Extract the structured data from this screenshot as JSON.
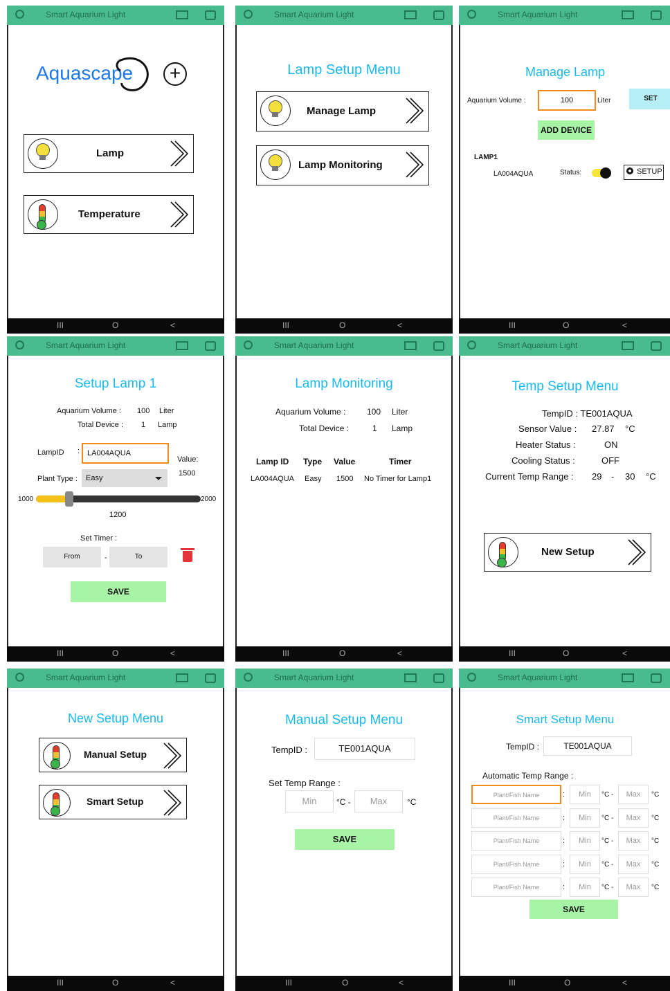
{
  "app_title": "Smart Aquarium Light",
  "nav": {
    "recents": "III",
    "home": "O",
    "back": "<"
  },
  "s1": {
    "logo": "Aquascape",
    "add": "+",
    "lamp": "Lamp",
    "temperature": "Temperature"
  },
  "s2": {
    "heading": "Lamp Setup Menu",
    "manage": "Manage Lamp",
    "monitoring": "Lamp Monitoring"
  },
  "s3": {
    "heading": "Manage Lamp",
    "vol_label": "Aquarium Volume :",
    "vol_value": "100",
    "unit": "Liter",
    "set": "SET",
    "add_device": "ADD DEVICE",
    "lamp_name": "LAMP1",
    "lamp_id": "LA004AQUA",
    "status_label": "Status:",
    "setup": "SETUP"
  },
  "s4": {
    "heading": "Setup Lamp 1",
    "vol_label": "Aquarium Volume :",
    "vol_value": "100",
    "vol_unit": "Liter",
    "dev_label": "Total Device :",
    "dev_value": "1",
    "dev_unit": "Lamp",
    "lampid_label": "LampID",
    "colon": ":",
    "lampid_value": "LA004AQUA",
    "value_label": "Value:",
    "value": "1500",
    "plant_label": "Plant Type :",
    "plant_value": "Easy",
    "slider_min": "1000",
    "slider_max": "2000",
    "slider_value": "1200",
    "slider_level": 0.2,
    "timer_label": "Set Timer :",
    "from": "From",
    "dash": "-",
    "to": "To",
    "save": "SAVE"
  },
  "s5": {
    "heading": "Lamp Monitoring",
    "vol_label": "Aquarium Volume :",
    "vol_value": "100",
    "vol_unit": "Liter",
    "dev_label": "Total Device :",
    "dev_value": "1",
    "dev_unit": "Lamp",
    "columns": [
      "Lamp ID",
      "Type",
      "Value",
      "Timer"
    ],
    "rows": [
      [
        "LA004AQUA",
        "Easy",
        "1500",
        "No Timer for Lamp1"
      ]
    ]
  },
  "s6": {
    "heading": "Temp Setup Menu",
    "tempid": "TempID : TE001AQUA",
    "sensor_label": "Sensor Value :",
    "sensor_value": "27.87",
    "deg": "°C",
    "heater_label": "Heater Status :",
    "heater_value": "ON",
    "cooling_label": "Cooling Status :",
    "cooling_value": "OFF",
    "range_label": "Current Temp Range :",
    "range_min": "29",
    "range_dash": "-",
    "range_max": "30",
    "new_setup": "New Setup"
  },
  "s7": {
    "heading": "New Setup Menu",
    "manual": "Manual Setup",
    "smart": "Smart Setup"
  },
  "s8": {
    "heading": "Manual Setup Menu",
    "tempid_label": "TempID :",
    "tempid_value": "TE001AQUA",
    "range_label": "Set Temp Range :",
    "min_ph": "Min",
    "max_ph": "Max",
    "c_dash": "°C -",
    "c": "°C",
    "save": "SAVE"
  },
  "s9": {
    "heading": "Smart Setup Menu",
    "tempid_label": "TempID :",
    "tempid_value": "TE001AQUA",
    "auto_label": "Automatic Temp Range :",
    "name_ph": "Plant/Fish Name",
    "min_ph": "Min",
    "max_ph": "Max",
    "colon": ":",
    "c_dash": "°C -",
    "c": "°C",
    "save": "SAVE"
  }
}
